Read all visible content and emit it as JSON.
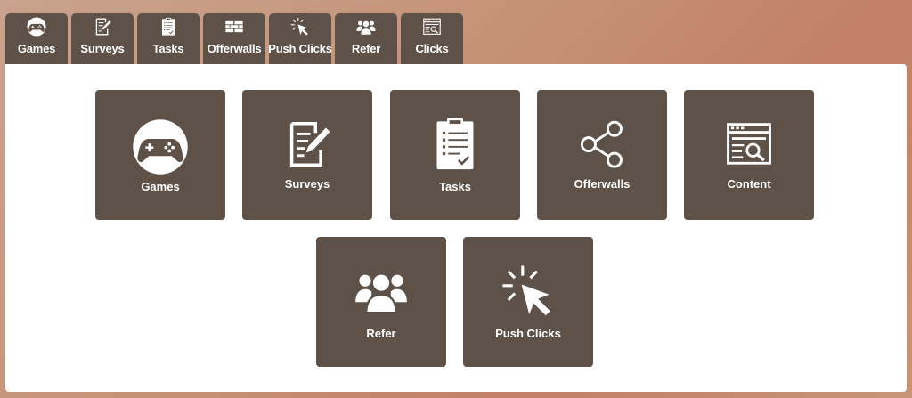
{
  "tabs": [
    {
      "label": "Games",
      "icon": "gamepad-icon"
    },
    {
      "label": "Surveys",
      "icon": "survey-icon"
    },
    {
      "label": "Tasks",
      "icon": "clipboard-icon"
    },
    {
      "label": "Offerwalls",
      "icon": "wall-icon"
    },
    {
      "label": "Push Clicks",
      "icon": "cursor-click-icon"
    },
    {
      "label": "Refer",
      "icon": "group-icon"
    },
    {
      "label": "Clicks",
      "icon": "browser-search-icon"
    }
  ],
  "cards": [
    {
      "label": "Games",
      "icon": "gamepad-icon"
    },
    {
      "label": "Surveys",
      "icon": "survey-icon"
    },
    {
      "label": "Tasks",
      "icon": "clipboard-icon"
    },
    {
      "label": "Offerwalls",
      "icon": "share-nodes-icon"
    },
    {
      "label": "Content",
      "icon": "browser-search-icon"
    },
    {
      "label": "Refer",
      "icon": "group-icon"
    },
    {
      "label": "Push Clicks",
      "icon": "cursor-click-icon"
    }
  ],
  "colors": {
    "tile": "#5e5148",
    "panel": "#ffffff",
    "text": "#ffffff"
  }
}
